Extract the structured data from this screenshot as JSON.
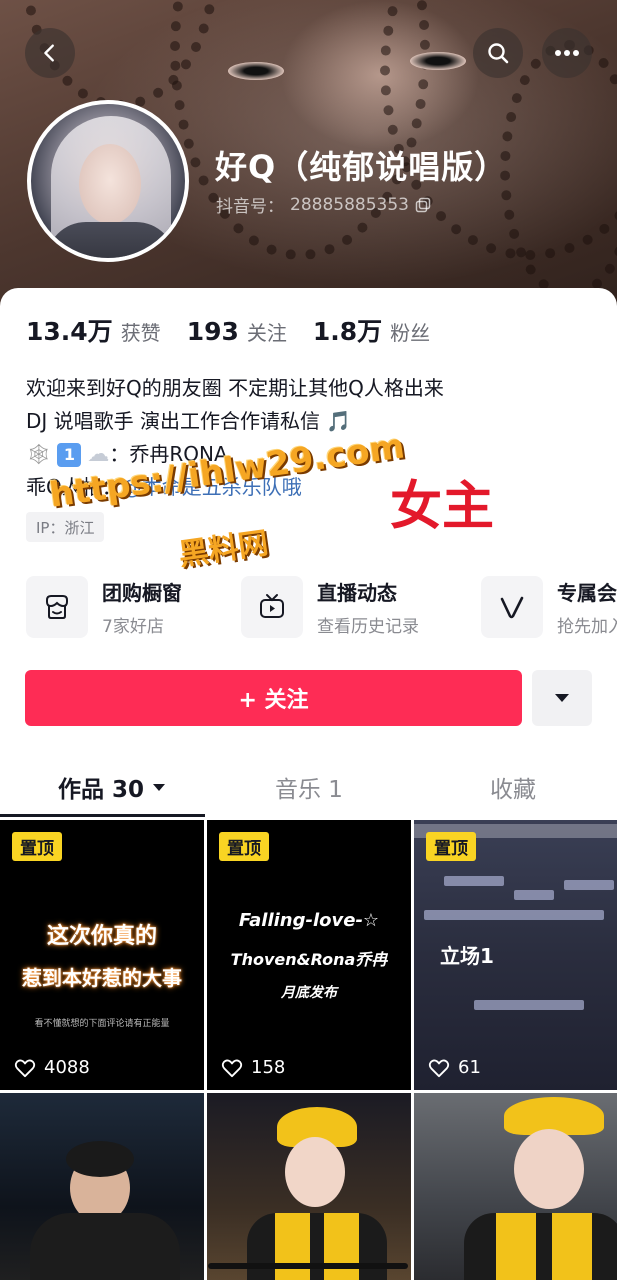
{
  "header": {
    "nickname": "好Q（纯郁说唱版）",
    "douyin_id_label": "抖音号：",
    "douyin_id": "28885885353"
  },
  "stats": [
    {
      "value": "13.4万",
      "label": "获赞"
    },
    {
      "value": "193",
      "label": "关注"
    },
    {
      "value": "1.8万",
      "label": "粉丝"
    }
  ],
  "bio": {
    "line1": "欢迎来到好Q的朋友圈 不定期让其他Q人格出来",
    "line2": " DJ 说唱歌手 演出工作合作请私信 🎵",
    "line3_prefix": "：乔冉RONA",
    "line4_prefix": "乖Q人格：",
    "line4_link": "@本命是五杀乐队哦"
  },
  "ip_tag": "IP：浙江",
  "overlay": {
    "watermark_url": "https://ihlw29.com",
    "watermark_name": "黑料网",
    "red_text": "女主"
  },
  "services": [
    {
      "title": "团购橱窗",
      "subtitle": "7家好店",
      "icon": "shop-window-icon"
    },
    {
      "title": "直播动态",
      "subtitle": "查看历史记录",
      "icon": "live-tv-icon"
    },
    {
      "title": "专属会",
      "subtitle": "抢先加入",
      "icon": "vip-icon"
    }
  ],
  "follow_button": "+ 关注",
  "tabs": [
    {
      "label": "作品 30",
      "active": true
    },
    {
      "label": "音乐 1",
      "active": false
    },
    {
      "label": "收藏",
      "active": false
    }
  ],
  "videos": [
    {
      "pinned": "置顶",
      "likes": "4088",
      "line1": "这次你真的",
      "line2": "惹到本好惹的大事",
      "small": "看不懂就想的下面评论请有正能量"
    },
    {
      "pinned": "置顶",
      "likes": "158",
      "line1": "Falling-love-☆",
      "line2": "Thoven&Rona乔冉",
      "line3": "月底发布"
    },
    {
      "pinned": "置顶",
      "likes": "61",
      "line1": "立场1"
    }
  ],
  "colors": {
    "accent": "#fe2c55",
    "pin_badge": "#f9d423",
    "link": "#3d6fb6"
  }
}
